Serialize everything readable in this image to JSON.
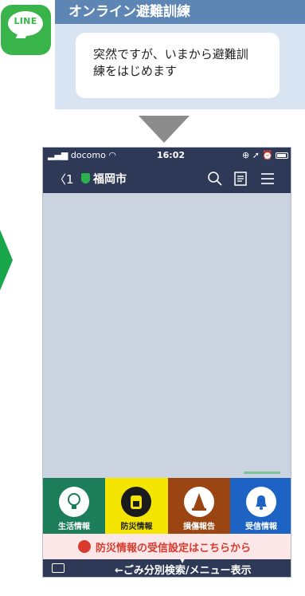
{
  "logo": {
    "text": "LINE",
    "icon": "line-logo-icon"
  },
  "banner": {
    "title": "オンライン避難訓練",
    "message_line1": "突然ですが、いまから避難訓",
    "message_line2": "練をはじめます"
  },
  "status_bar": {
    "carrier": "docomo",
    "time": "16:02"
  },
  "nav": {
    "back_count": "1",
    "title": "福岡市"
  },
  "rich_menu": [
    {
      "label": "生活情報",
      "icon": "lightbulb-icon",
      "color": "#1b7d5a"
    },
    {
      "label": "防災情報",
      "icon": "backpack-icon",
      "color": "#f4e500"
    },
    {
      "label": "損傷報告",
      "icon": "traffic-cone-icon",
      "color": "#9a4512"
    },
    {
      "label": "受信情報",
      "icon": "bell-icon",
      "color": "#1d63c4"
    }
  ],
  "settings_link": {
    "text": "防災情報の受信設定はこちらから"
  },
  "bottom_bar": {
    "label": "←ごみ分別検索/メニュー表示"
  }
}
